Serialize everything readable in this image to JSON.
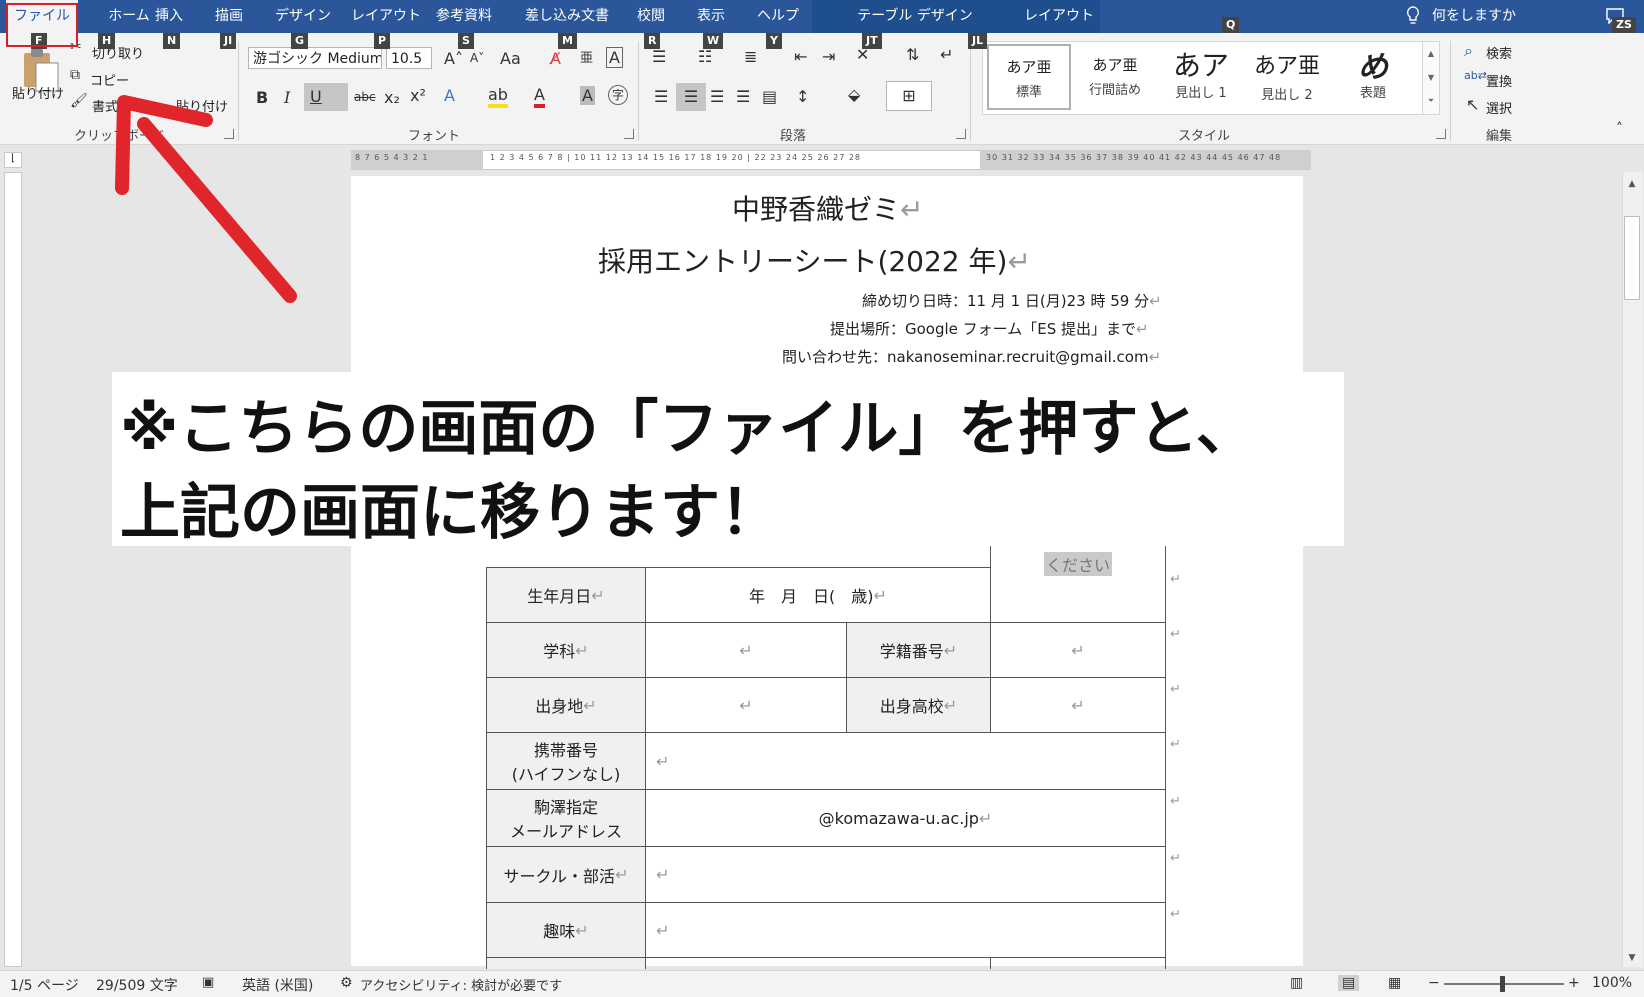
{
  "menu": {
    "tabs": [
      {
        "label": "ファイル",
        "key": "F"
      },
      {
        "label": "ホーム",
        "key": "H"
      },
      {
        "label": "挿入",
        "key": "N"
      },
      {
        "label": "描画",
        "key": "JI"
      },
      {
        "label": "デザイン",
        "key": "G"
      },
      {
        "label": "レイアウト",
        "key": "P"
      },
      {
        "label": "参考資料",
        "key": "S"
      },
      {
        "label": "差し込み文書",
        "key": "M"
      },
      {
        "label": "校閲",
        "key": "R"
      },
      {
        "label": "表示",
        "key": "W"
      },
      {
        "label": "ヘルプ",
        "key": "Y"
      },
      {
        "label": "テーブル デザイン",
        "key": "JT"
      },
      {
        "label": "レイアウト",
        "key": "JL"
      }
    ],
    "tell_me": "何をしますか",
    "tell_me_key": "Q",
    "user_key": "ZS"
  },
  "ribbon": {
    "clipboard": {
      "paste": "貼り付け",
      "cut": "切り取り",
      "copy": "コピー",
      "format_painter": "書式",
      "format_painter_tail": "貼り付け",
      "label": "クリップボード"
    },
    "font": {
      "family": "游ゴシック Medium",
      "size": "10.5",
      "label": "フォント"
    },
    "paragraph": {
      "label": "段落"
    },
    "styles": {
      "label": "スタイル",
      "items": [
        {
          "sample": "あア亜",
          "name": "標準"
        },
        {
          "sample": "あア亜",
          "name": "行間詰め"
        },
        {
          "sample": "あア",
          "name": "見出し 1"
        },
        {
          "sample": "あア亜",
          "name": "見出し 2"
        },
        {
          "sample": "め",
          "name": "表題"
        }
      ]
    },
    "editing": {
      "find": "検索",
      "replace": "置換",
      "select": "選択",
      "label": "編集"
    }
  },
  "document": {
    "title": "中野香織ゼミ",
    "subtitle": "採用エントリーシート(2022 年)",
    "deadline": "締め切り日時：11 月 1 日(月)23 時 59 分",
    "submit": "提出場所：Google フォーム「ES 提出」まで",
    "contact": "問い合わせ先：nakanoseminar.recruit@gmail.com",
    "table": {
      "photo_hint": "ください",
      "birthday_label": "生年月日",
      "birthday_value": "年　月　日(　歳)",
      "dept_label": "学科",
      "student_no_label": "学籍番号",
      "hometown_label": "出身地",
      "high_school_label": "出身高校",
      "mobile_label_1": "携帯番号",
      "mobile_label_2": "(ハイフンなし)",
      "mail_label_1": "駒澤指定",
      "mail_label_2": "メールアドレス",
      "mail_value": "@komazawa-u.ac.jp",
      "club_label": "サークル・部活",
      "hobby_label": "趣味"
    }
  },
  "statusbar": {
    "page": "1/5 ページ",
    "words": "29/509 文字",
    "language": "英語 (米国)",
    "accessibility": "アクセシビリティ: 検討が必要です",
    "zoom": "100%"
  },
  "annotation": {
    "line1": "※こちらの画面の「ファイル」を押すと、",
    "line2": "上記の画面に移ります！",
    "arrow_color": "#e0262b"
  }
}
